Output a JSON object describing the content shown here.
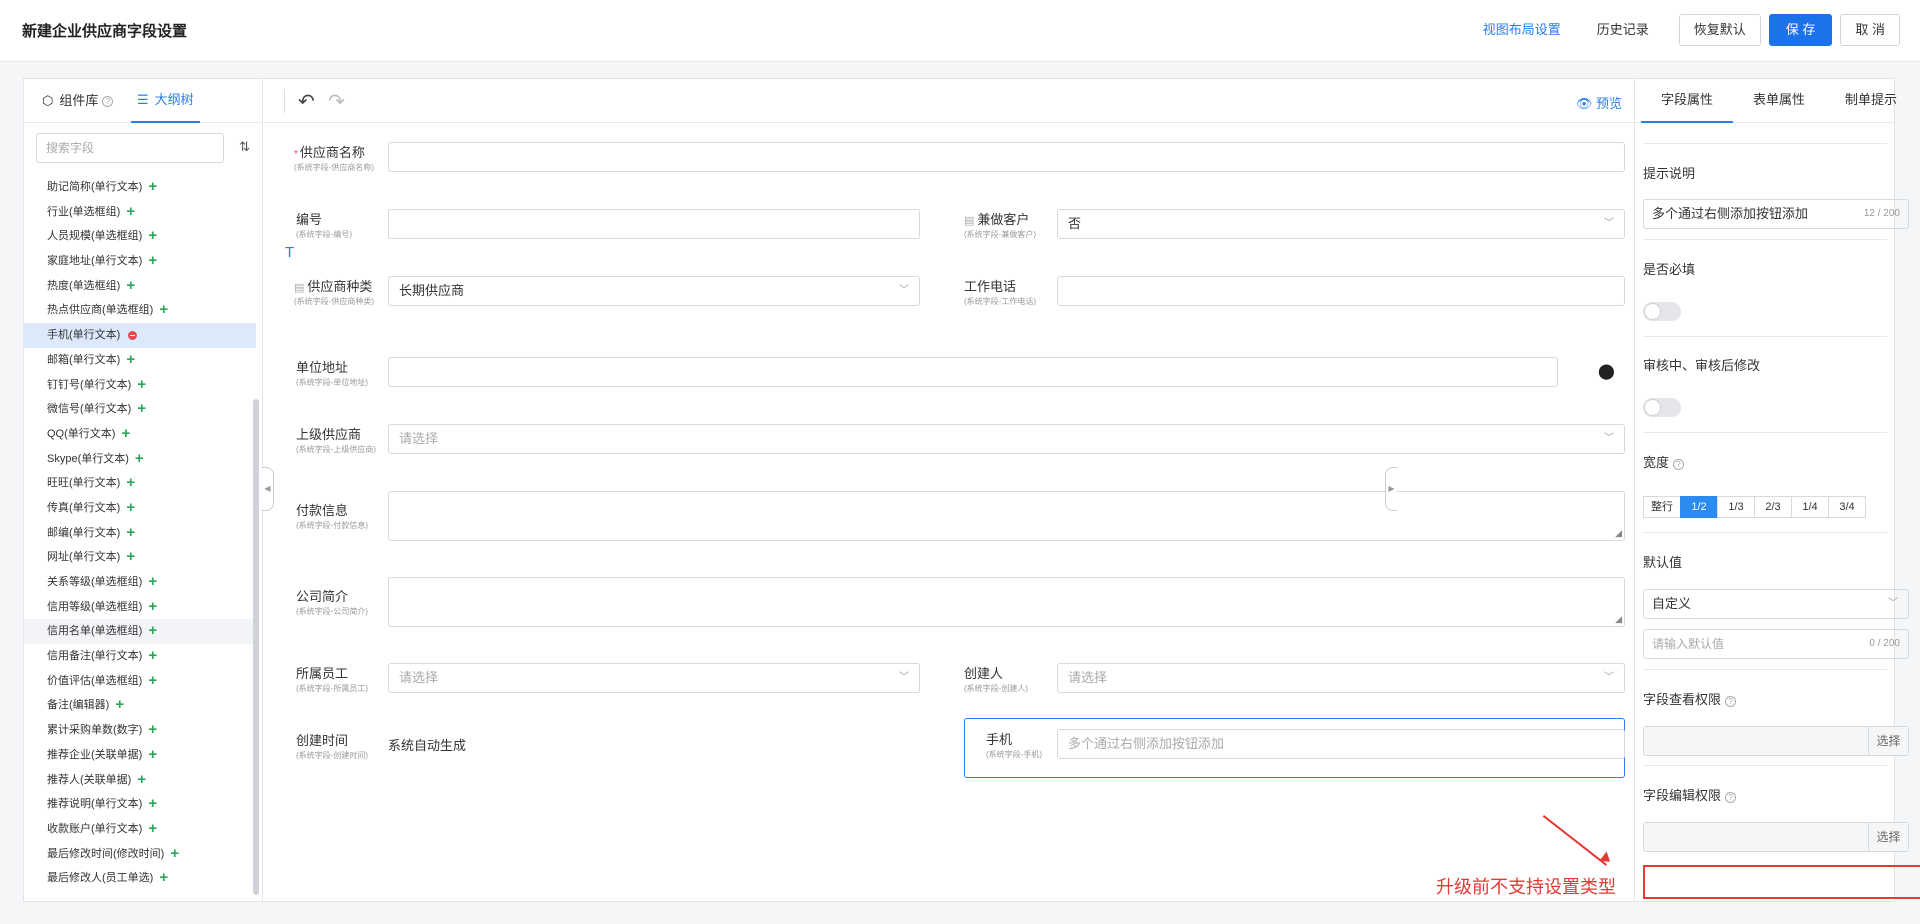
{
  "header": {
    "title": "新建企业供应商字段设置",
    "view_layout": "视图布局设置",
    "history": "历史记录",
    "restore": "恢复默认",
    "save": "保 存",
    "cancel": "取 消"
  },
  "left_panel": {
    "tab_components": "组件库",
    "tab_outline": "大纲树",
    "search_placeholder": "搜索字段",
    "fields": [
      "助记简称(单行文本)",
      "行业(单选框组)",
      "人员规模(单选框组)",
      "家庭地址(单行文本)",
      "热度(单选框组)",
      "热点供应商(单选框组)",
      "手机(单行文本)",
      "邮箱(单行文本)",
      "钉钉号(单行文本)",
      "微信号(单行文本)",
      "QQ(单行文本)",
      "Skype(单行文本)",
      "旺旺(单行文本)",
      "传真(单行文本)",
      "邮编(单行文本)",
      "网址(单行文本)",
      "关系等级(单选框组)",
      "信用等级(单选框组)",
      "信用名单(单选框组)",
      "信用备注(单行文本)",
      "价值评估(单选框组)",
      "备注(编辑器)",
      "累计采购单数(数字)",
      "推荐企业(关联单据)",
      "推荐人(关联单据)",
      "推荐说明(单行文本)",
      "收款账户(单行文本)",
      "最后修改时间(修改时间)",
      "最后修改人(员工单选)"
    ]
  },
  "center": {
    "preview": "预览",
    "supplier_name": {
      "label": "供应商名称",
      "sub": "(系统字段-供应商名称)"
    },
    "code": {
      "label": "编号",
      "sub": "(系统字段-编号)"
    },
    "also_customer": {
      "label": "兼做客户",
      "sub": "(系统字段-兼做客户)",
      "value": "否"
    },
    "supplier_type": {
      "label": "供应商种类",
      "sub": "(系统字段-供应商种类)",
      "value": "长期供应商"
    },
    "work_phone": {
      "label": "工作电话",
      "sub": "(系统字段-工作电话)"
    },
    "address": {
      "label": "单位地址",
      "sub": "(系统字段-单位地址)"
    },
    "parent_supplier": {
      "label": "上级供应商",
      "sub": "(系统字段-上级供应商)",
      "placeholder": "请选择"
    },
    "payment_info": {
      "label": "付款信息",
      "sub": "(系统字段-付款信息)"
    },
    "company_intro": {
      "label": "公司简介",
      "sub": "(系统字段-公司简介)"
    },
    "employee": {
      "label": "所属员工",
      "sub": "(系统字段-所属员工)",
      "placeholder": "请选择"
    },
    "creator": {
      "label": "创建人",
      "sub": "(系统字段-创建人)",
      "placeholder": "请选择"
    },
    "create_time": {
      "label": "创建时间",
      "sub": "(系统字段-创建时间)",
      "value": "系统自动生成"
    },
    "mobile": {
      "label": "手机",
      "sub": "(系统字段-手机)",
      "placeholder": "多个通过右侧添加按钮添加"
    },
    "annotation": "升级前不支持设置类型"
  },
  "right_panel": {
    "tab_field": "字段属性",
    "tab_form": "表单属性",
    "tab_tips": "制单提示",
    "hint_label": "提示说明",
    "hint_value": "多个通过右侧添加按钮添加",
    "hint_count": "12 / 200",
    "required_label": "是否必填",
    "edit_label": "审核中、审核后修改",
    "width_label": "宽度",
    "width_options": [
      "整行",
      "1/2",
      "1/3",
      "2/3",
      "1/4",
      "3/4"
    ],
    "default_label": "默认值",
    "default_type": "自定义",
    "default_placeholder": "请输入默认值",
    "default_count": "0 / 200",
    "view_perm_label": "字段查看权限",
    "edit_perm_label": "字段编辑权限",
    "select": "选择"
  }
}
